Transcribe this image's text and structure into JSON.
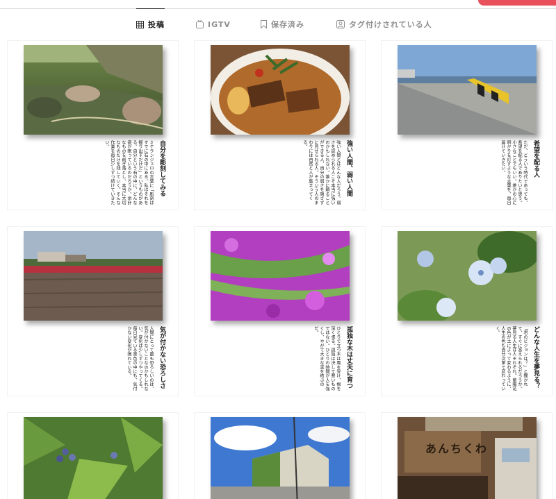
{
  "tabs": [
    {
      "label": "投稿",
      "icon": "grid-icon",
      "active": true
    },
    {
      "label": "IGTV",
      "icon": "igtv-icon",
      "active": false
    },
    {
      "label": "保存済み",
      "icon": "bookmark-icon",
      "active": false
    },
    {
      "label": "タグ付けされている人",
      "icon": "tagged-person-icon",
      "active": false
    }
  ],
  "posts": [
    {
      "heading": "自分を彫刻してみる",
      "body": "ミケランジェロの言葉に「彫刻はすでに石の中にある。私はそれを掘り出すだけだ」というものがある。自分という石の中に、どんな姿が眠っているのだろうか。余計なものを削ぎ落とし、本当に大切なものだけを残していく。そんな作業を毎日少しずつ続けていきたい。",
      "image": "stream-photo"
    },
    {
      "heading": "強い人間、弱い人間",
      "body": "強い人間とはどんな人だろう。弱さを認められる人こそ本当に強いのかもしれない。誰かに頼ることができる人、自分の弱さを隠さずに見せられる人。そういう人のまわりには自然と人が集まってくる。",
      "image": "curry-photo"
    },
    {
      "heading": "希望を配る人",
      "body": "ただ、どういう時代であっても、希望を配る人でありたいと思う。小さなことでもいい。誰かの心に明かりを灯すような言葉を、毎日届けていきたい。",
      "image": "pier-photo"
    },
    {
      "heading": "気が付かない恐ろしさ",
      "body": "人間にとって最も恐ろしいのは、気が付かないことなのかもしれない。変化は少しずつやってくる。毎日見ている景色の中にも、気付かない変化が隠れている。",
      "image": "field-photo"
    },
    {
      "heading": "孤独な木は丈夫に育つ",
      "body": "ひとりで立つ木は風を受け、根を深く張る。孤独は決して悪いものではない。ひとりの時間が人を強くし、やがて大きな実を結ぶのだ。",
      "image": "flowers-photo"
    },
    {
      "heading": "どんな人生を夢見る？",
      "body": "「君のビジョンは？」と聞かれて、すぐに答えられるだろうか。夢見る人生は人それぞれ。紫陽花の色が土によって変わるように、人生の色も自分次第で変わっていく。",
      "image": "hydrangea-photo"
    },
    {
      "heading": "",
      "body": "",
      "image": "berries-photo"
    },
    {
      "heading": "",
      "body": "",
      "image": "building-photo"
    },
    {
      "heading": "",
      "body": "",
      "image": "storefront-photo"
    }
  ],
  "storefront_sign": "あんちくわ"
}
